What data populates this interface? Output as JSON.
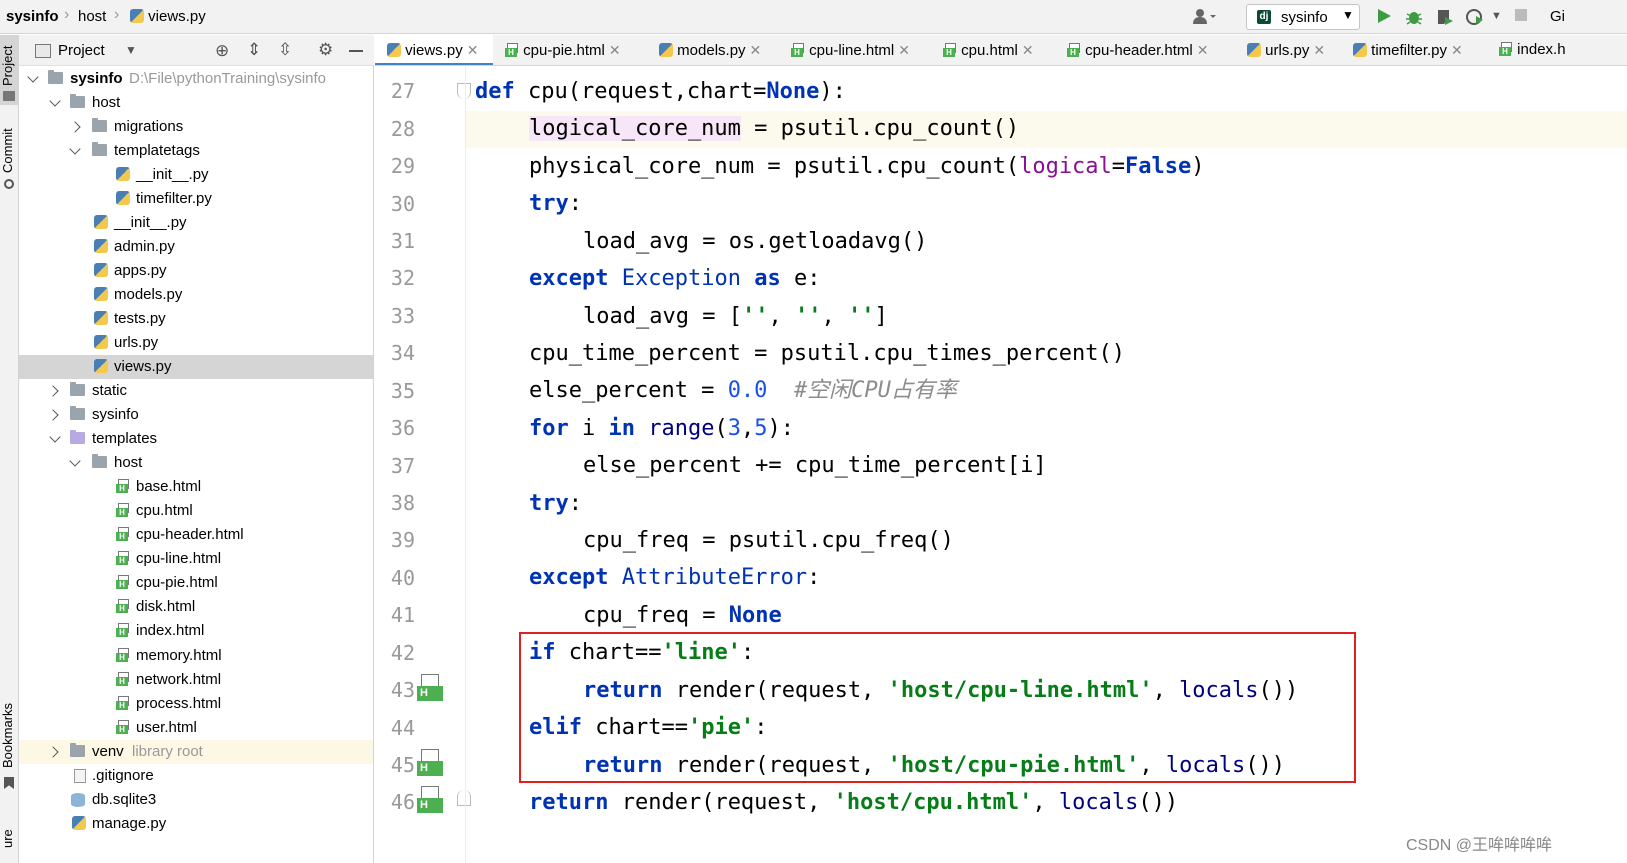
{
  "breadcrumb": {
    "project": "sysinfo",
    "folder": "host",
    "file": "views.py"
  },
  "toolbar": {
    "run_config": "sysinfo",
    "git_label": "Gi"
  },
  "left_strip": {
    "project_label": "Project",
    "commit_label": "Commit",
    "bookmarks_label": "Bookmarks",
    "structure_label": "ure"
  },
  "project_panel": {
    "title": "Project"
  },
  "tree": {
    "root_name": "sysinfo",
    "root_path": "D:\\File\\pythonTraining\\sysinfo",
    "host": "host",
    "migrations": "migrations",
    "templatetags": "templatetags",
    "tt_init": "__init__.py",
    "timefilter": "timefilter.py",
    "init": "__init__.py",
    "admin": "admin.py",
    "apps": "apps.py",
    "models": "models.py",
    "tests": "tests.py",
    "urls": "urls.py",
    "views": "views.py",
    "static": "static",
    "sysinfo": "sysinfo",
    "templates": "templates",
    "t_host": "host",
    "base": "base.html",
    "cpu": "cpu.html",
    "cpu_header": "cpu-header.html",
    "cpu_line": "cpu-line.html",
    "cpu_pie": "cpu-pie.html",
    "disk": "disk.html",
    "index": "index.html",
    "memory": "memory.html",
    "network": "network.html",
    "process": "process.html",
    "user": "user.html",
    "venv": "venv",
    "venv_note": "library root",
    "gitignore": ".gitignore",
    "db": "db.sqlite3",
    "manage": "manage.py"
  },
  "tabs": [
    "views.py",
    "cpu-pie.html",
    "models.py",
    "cpu-line.html",
    "cpu.html",
    "cpu-header.html",
    "urls.py",
    "timefilter.py",
    "index.h"
  ],
  "line_numbers": [
    "27",
    "28",
    "29",
    "30",
    "31",
    "32",
    "33",
    "34",
    "35",
    "36",
    "37",
    "38",
    "39",
    "40",
    "41",
    "42",
    "43",
    "44",
    "45",
    "46"
  ],
  "code": {
    "l27a": "def",
    "l27b": " cpu(request,chart=",
    "l27c": "None",
    "l27d": "):",
    "l28a": "logical_core_num",
    "l28b": " = psutil.cpu_count()",
    "l29a": "physical_core_num = psutil.cpu_count(",
    "l29b": "logical",
    "l29c": "=",
    "l29d": "False",
    "l29e": ")",
    "l30a": "try",
    "l30b": ":",
    "l31": "load_avg = os.getloadavg()",
    "l32a": "except",
    "l32b": " ",
    "l32c": "Exception",
    "l32d": " ",
    "l32e": "as",
    "l32f": " e:",
    "l33a": "load_avg = [",
    "l33b": "''",
    "l33c": ", ",
    "l33d": "''",
    "l33e": ", ",
    "l33f": "''",
    "l33g": "]",
    "l34": "cpu_time_percent = psutil.cpu_times_percent()",
    "l35a": "else_percent = ",
    "l35b": "0.0",
    "l35c": "  ",
    "l35d": "#空闲CPU占有率",
    "l36a": "for",
    "l36b": " i ",
    "l36c": "in",
    "l36d": " ",
    "l36e": "range",
    "l36f": "(",
    "l36g": "3",
    "l36h": ",",
    "l36i": "5",
    "l36j": "):",
    "l37": "else_percent += cpu_time_percent[i]",
    "l38a": "try",
    "l38b": ":",
    "l39": "cpu_freq = psutil.cpu_freq()",
    "l40a": "except",
    "l40b": " ",
    "l40c": "AttributeError",
    "l40d": ":",
    "l41a": "cpu_freq = ",
    "l41b": "None",
    "l42a": "if",
    "l42b": " chart==",
    "l42c": "'line'",
    "l42d": ":",
    "l43a": "return",
    "l43b": " render(request, ",
    "l43c": "'host/cpu-line.html'",
    "l43d": ", ",
    "l43e": "locals",
    "l43f": "())",
    "l44a": "elif",
    "l44b": " chart==",
    "l44c": "'pie'",
    "l44d": ":",
    "l45a": "return",
    "l45b": " render(request, ",
    "l45c": "'host/cpu-pie.html'",
    "l45d": ", ",
    "l45e": "locals",
    "l45f": "())",
    "l46a": "return",
    "l46b": " render(request, ",
    "l46c": "'host/cpu.html'",
    "l46d": ", ",
    "l46e": "locals",
    "l46f": "())"
  },
  "gutter_icon": "H",
  "watermark": "CSDN @王哞哞哞哞",
  "colors": {
    "keyword": "#0033b3",
    "string": "#067d17",
    "number": "#1750eb",
    "comment": "#8c8c8c",
    "highlight_box": "#e02020",
    "tab_underline": "#4083c9"
  }
}
